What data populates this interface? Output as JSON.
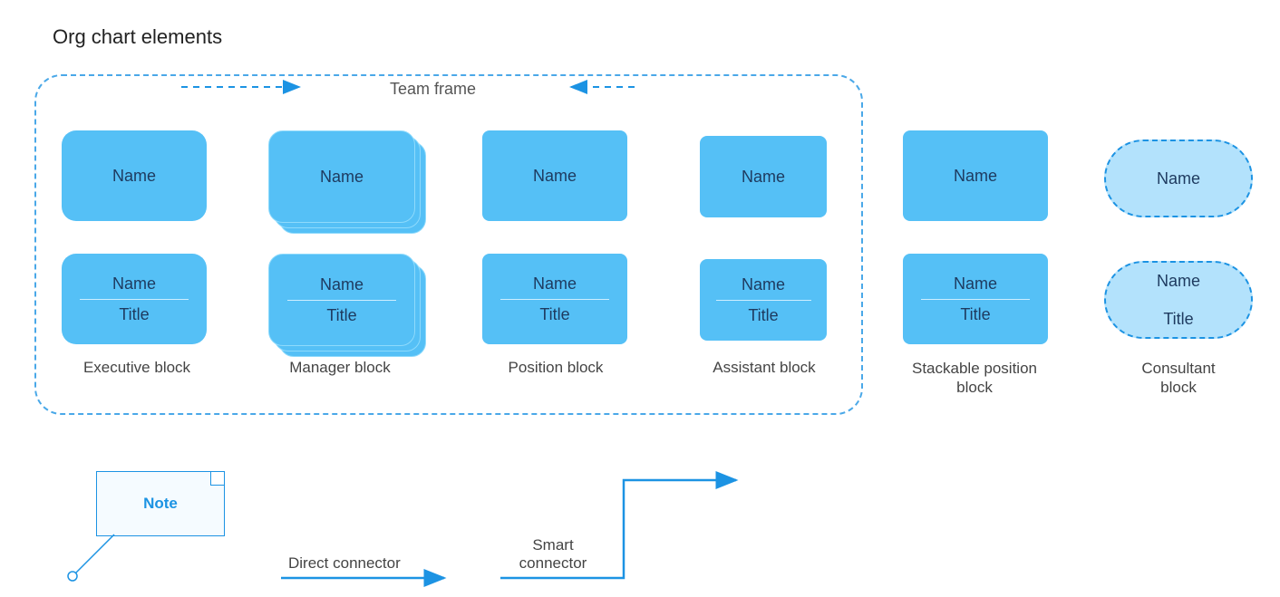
{
  "page_title": "Org chart elements",
  "team_frame_label": "Team frame",
  "labels": {
    "name": "Name",
    "title": "Title"
  },
  "columns": {
    "executive": "Executive block",
    "manager": "Manager block",
    "position": "Position block",
    "assistant": "Assistant block",
    "stackable": "Stackable position\nblock",
    "consultant": "Consultant\nblock"
  },
  "note": {
    "label": "Note"
  },
  "connectors": {
    "direct": "Direct connector",
    "smart": "Smart\nconnector"
  }
}
